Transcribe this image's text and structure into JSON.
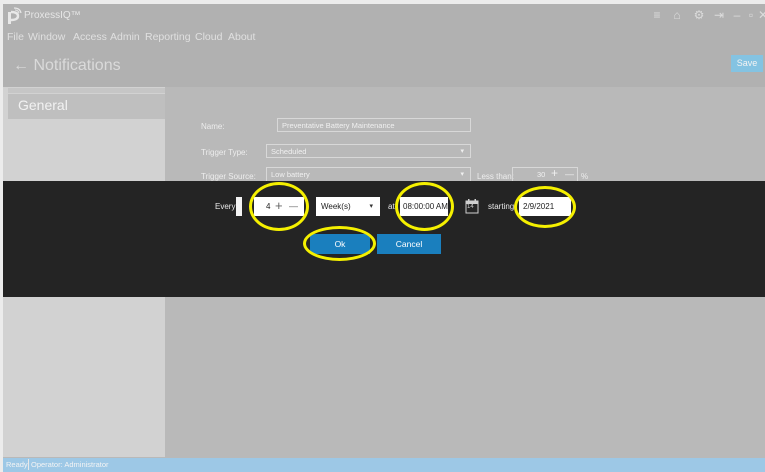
{
  "app": {
    "title": "ProxessIQ™"
  },
  "menu": [
    "File",
    "Window",
    "Access",
    "Admin",
    "Reporting",
    "Cloud",
    "About"
  ],
  "window_controls": [
    "≡",
    "⌂",
    "⚙",
    "⇥",
    "–",
    "▫",
    "✕"
  ],
  "page": {
    "back_arrow": "←",
    "title": "Notifications",
    "save_label": "Save"
  },
  "sidebar": {
    "general_label": "General"
  },
  "form": {
    "name_label": "Name:",
    "name_value": "Preventative Battery Maintenance",
    "trigger_type_label": "Trigger Type:",
    "trigger_type_value": "Scheduled",
    "trigger_source_label": "Trigger Source:",
    "trigger_source_value": "Low battery",
    "less_than_label": "Less than:",
    "less_than_value": "30",
    "percent_symbol": "%"
  },
  "dialog": {
    "every_label": "Every",
    "count_value": "4",
    "plus": "+",
    "minus": "—",
    "unit_value": "Week(s)",
    "at_label": "at",
    "time_value": "08:00:00 AM",
    "calendar_day": "14",
    "starting_label": "starting",
    "date_value": "2/9/2021",
    "ok_label": "Ok",
    "cancel_label": "Cancel"
  },
  "status": {
    "ready": "Ready",
    "operator": "Operator: Administrator"
  },
  "colors": {
    "accent": "#1a7fbe",
    "highlight": "#f5f000",
    "dialog_bg": "#242424"
  }
}
